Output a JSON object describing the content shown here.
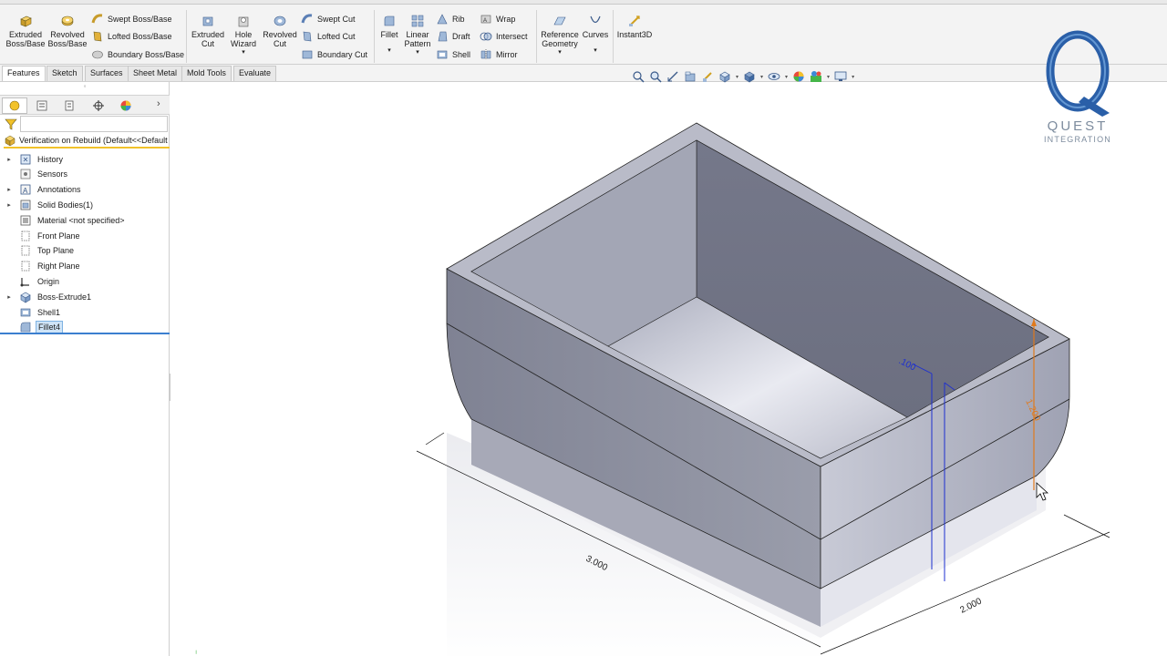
{
  "ribbon": {
    "extruded_boss": [
      "Extruded",
      "Boss/Base"
    ],
    "revolved_boss": [
      "Revolved",
      "Boss/Base"
    ],
    "swept_boss": "Swept Boss/Base",
    "lofted_boss": "Lofted Boss/Base",
    "boundary_boss": "Boundary Boss/Base",
    "extruded_cut": [
      "Extruded",
      "Cut"
    ],
    "hole_wizard": [
      "Hole",
      "Wizard"
    ],
    "revolved_cut": [
      "Revolved",
      "Cut"
    ],
    "swept_cut": "Swept Cut",
    "lofted_cut": "Lofted Cut",
    "boundary_cut": "Boundary Cut",
    "fillet": "Fillet",
    "linear_pattern": [
      "Linear",
      "Pattern"
    ],
    "rib": "Rib",
    "draft": "Draft",
    "shell": "Shell",
    "wrap": "Wrap",
    "intersect": "Intersect",
    "mirror": "Mirror",
    "reference_geometry": [
      "Reference",
      "Geometry"
    ],
    "curves": "Curves",
    "instant3d": "Instant3D"
  },
  "tabs": [
    {
      "label": "Features",
      "active": true
    },
    {
      "label": "Sketch",
      "active": false
    },
    {
      "label": "Surfaces",
      "active": false
    },
    {
      "label": "Sheet Metal",
      "active": false
    },
    {
      "label": "Mold Tools",
      "active": false
    },
    {
      "label": "Evaluate",
      "active": false
    }
  ],
  "feature_tree": {
    "root": "Verification on Rebuild  (Default<<Default",
    "items": [
      {
        "label": "History",
        "expandable": true,
        "icon": "history-icon"
      },
      {
        "label": "Sensors",
        "expandable": false,
        "icon": "sensor-icon"
      },
      {
        "label": "Annotations",
        "expandable": true,
        "icon": "annotation-icon"
      },
      {
        "label": "Solid Bodies(1)",
        "expandable": true,
        "icon": "solid-bodies-icon"
      },
      {
        "label": "Material <not specified>",
        "expandable": false,
        "icon": "material-icon"
      },
      {
        "label": "Front Plane",
        "expandable": false,
        "icon": "plane-icon"
      },
      {
        "label": "Top Plane",
        "expandable": false,
        "icon": "plane-icon"
      },
      {
        "label": "Right Plane",
        "expandable": false,
        "icon": "plane-icon"
      },
      {
        "label": "Origin",
        "expandable": false,
        "icon": "origin-icon"
      },
      {
        "label": "Boss-Extrude1",
        "expandable": true,
        "icon": "extrude-icon"
      },
      {
        "label": "Shell1",
        "expandable": false,
        "icon": "shell-icon"
      },
      {
        "label": "Fillet4",
        "expandable": false,
        "icon": "fillet-icon",
        "selected": true
      }
    ]
  },
  "logo": {
    "name": "QUEST",
    "subtitle": "INTEGRATION"
  },
  "dimensions": {
    "length": "3.000",
    "width": "2.000",
    "wall": ".100",
    "height": "1.200"
  },
  "colors": {
    "ribbon_bg": "#f3f3f3",
    "selection": "#cfe4f7",
    "accent_yellow": "#f2c22a",
    "model_face": "#8b8e9c",
    "dimension_blue": "#1d2fd0",
    "dimension_orange": "#e07a1c",
    "logo_blue": "#2a5fa8"
  }
}
